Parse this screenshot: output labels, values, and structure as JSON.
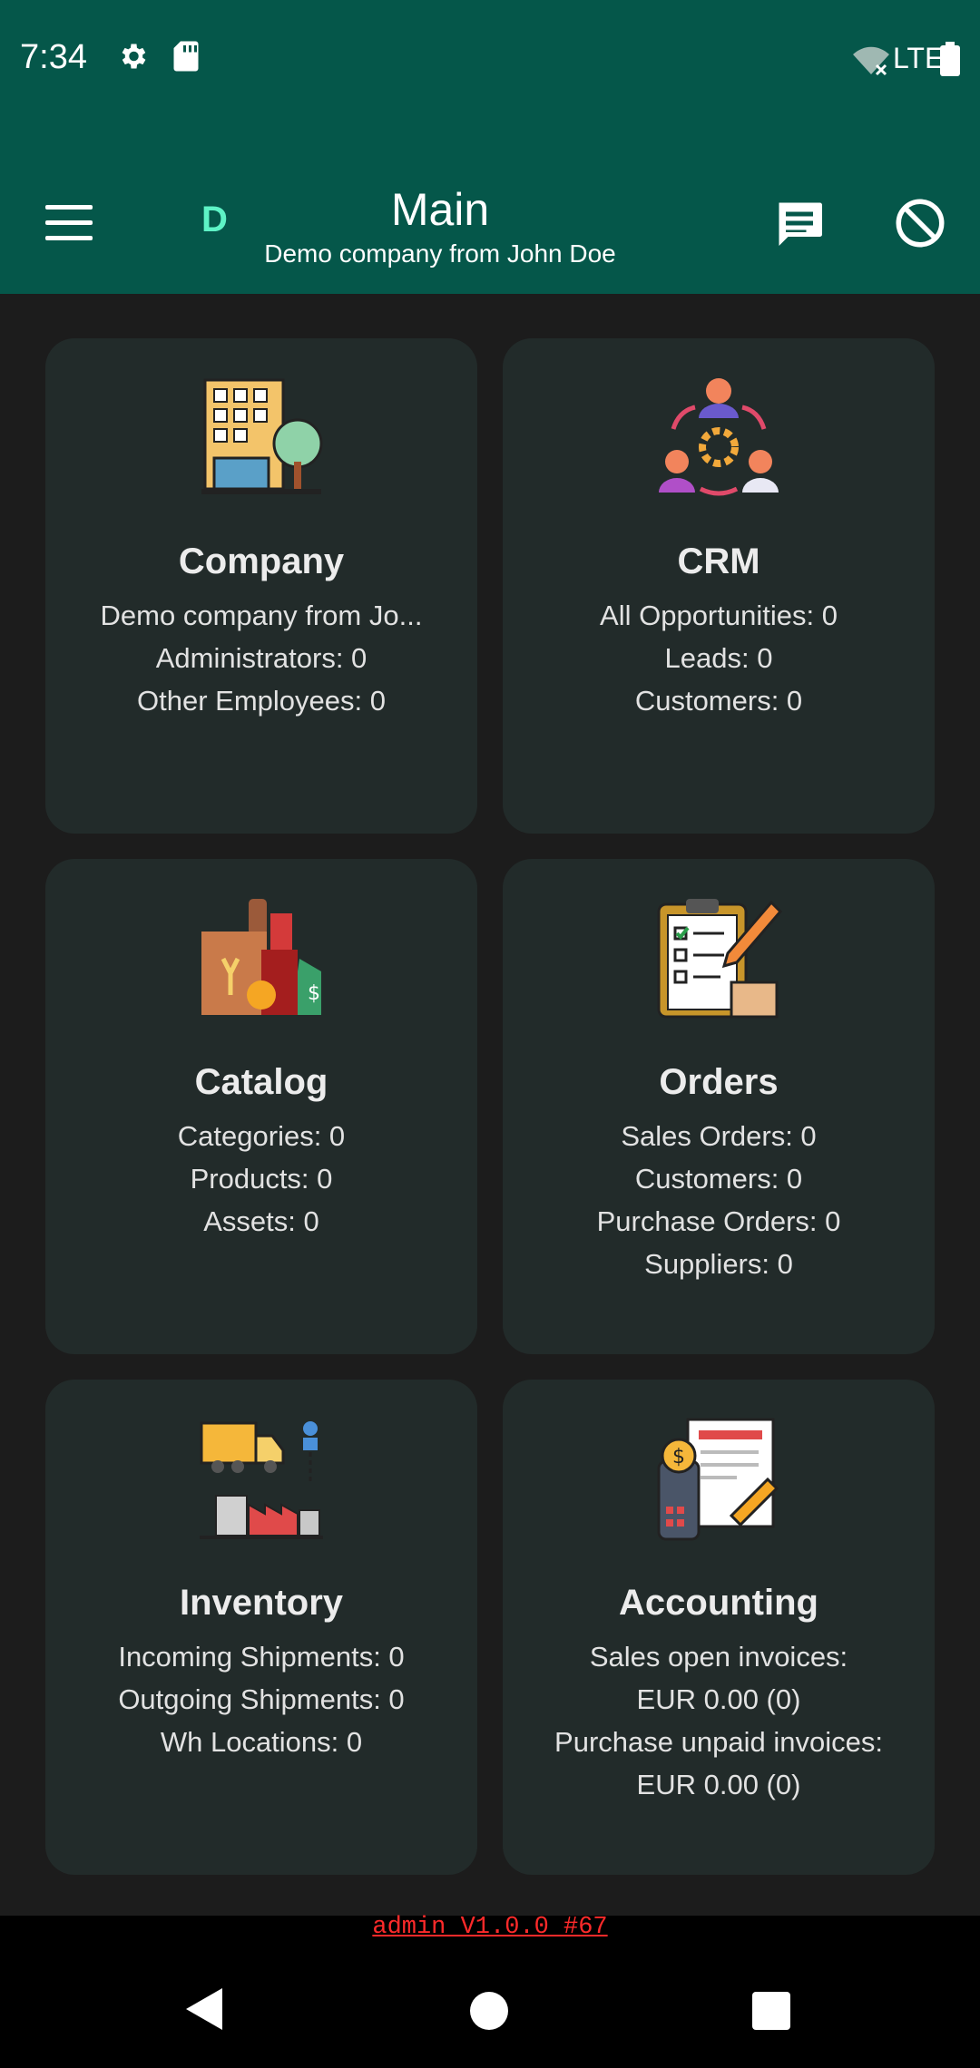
{
  "status_bar": {
    "time": "7:34",
    "icons": [
      "settings-icon",
      "sd-card-icon",
      "wifi-off-icon",
      "lte-indicator",
      "battery-icon"
    ],
    "network_label": "LTE"
  },
  "app_bar": {
    "avatar_letter": "D",
    "title": "Main",
    "subtitle": "Demo company from John Doe"
  },
  "cards": [
    {
      "title": "Company",
      "icon": "company-building-icon",
      "lines": [
        "Demo company from Jo...",
        "Administrators: 0",
        "Other Employees: 0"
      ]
    },
    {
      "title": "CRM",
      "icon": "crm-people-icon",
      "lines": [
        "All Opportunities: 0",
        "Leads: 0",
        "Customers: 0"
      ]
    },
    {
      "title": "Catalog",
      "icon": "catalog-products-icon",
      "lines": [
        "Categories: 0",
        "Products: 0",
        "Assets: 0"
      ]
    },
    {
      "title": "Orders",
      "icon": "orders-clipboard-icon",
      "lines": [
        "Sales Orders: 0",
        "Customers: 0",
        "Purchase Orders: 0",
        "Suppliers: 0"
      ]
    },
    {
      "title": "Inventory",
      "icon": "inventory-truck-icon",
      "lines": [
        "Incoming Shipments: 0",
        "Outgoing Shipments: 0",
        "Wh Locations: 0"
      ]
    },
    {
      "title": "Accounting",
      "icon": "accounting-invoice-icon",
      "lines": [
        "Sales open invoices:",
        "EUR 0.00 (0)",
        "Purchase unpaid invoices:",
        "EUR 0.00 (0)"
      ]
    }
  ],
  "footer": {
    "version": "admin V1.0.0 #67"
  },
  "colors": {
    "app_bar": "#05574a",
    "background": "#1c1c1c",
    "card": "#222b2a",
    "accent_letter": "#5ef3c6",
    "version_text": "#ff2a2a"
  }
}
